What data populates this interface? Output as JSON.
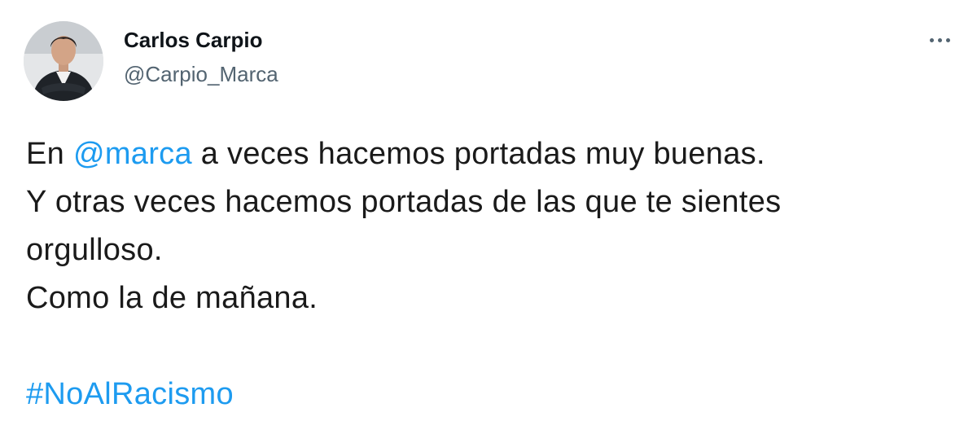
{
  "author": {
    "display_name": "Carlos Carpio",
    "handle": "@Carpio_Marca"
  },
  "tweet": {
    "line1_prefix": "En ",
    "mention": "@marca",
    "line1_suffix": " a veces hacemos portadas muy buenas.",
    "line2": "Y otras veces hacemos portadas de las que te sientes",
    "line3": "orgulloso.",
    "line4": "Como la de mañana.",
    "hashtag": "#NoAlRacismo"
  },
  "icons": {
    "more": "more-dots-icon",
    "avatar": "profile-photo"
  },
  "colors": {
    "link": "#1d9bf0",
    "text": "#0f1419",
    "secondary": "#536471"
  }
}
